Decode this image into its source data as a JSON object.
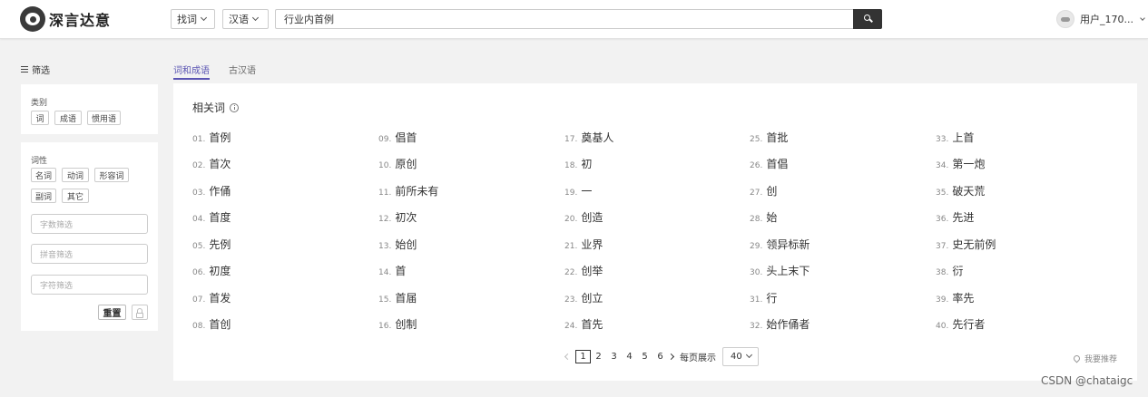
{
  "header": {
    "logo_text": "深言达意",
    "mode_select": "找词",
    "lang_select": "汉语",
    "search_value": "行业内首例",
    "user_name": "用户_170..."
  },
  "sidebar": {
    "filter_title": "筛选",
    "category_label": "类别",
    "category_tags": [
      "词",
      "成语",
      "惯用语"
    ],
    "pos_label": "词性",
    "pos_tags": [
      "名词",
      "动词",
      "形容词",
      "副词",
      "其它"
    ],
    "fields": [
      "字数筛选",
      "拼音筛选",
      "字符筛选"
    ],
    "reset_label": "重置"
  },
  "tabs": [
    {
      "label": "词和成语"
    },
    {
      "label": "古汉语"
    }
  ],
  "results": {
    "title": "相关词",
    "words": [
      {
        "num": "01.",
        "text": "首例"
      },
      {
        "num": "02.",
        "text": "首次"
      },
      {
        "num": "03.",
        "text": "作俑"
      },
      {
        "num": "04.",
        "text": "首度"
      },
      {
        "num": "05.",
        "text": "先例"
      },
      {
        "num": "06.",
        "text": "初度"
      },
      {
        "num": "07.",
        "text": "首发"
      },
      {
        "num": "08.",
        "text": "首创"
      },
      {
        "num": "09.",
        "text": "倡首"
      },
      {
        "num": "10.",
        "text": "原创"
      },
      {
        "num": "11.",
        "text": "前所未有"
      },
      {
        "num": "12.",
        "text": "初次"
      },
      {
        "num": "13.",
        "text": "始创"
      },
      {
        "num": "14.",
        "text": "首"
      },
      {
        "num": "15.",
        "text": "首届"
      },
      {
        "num": "16.",
        "text": "创制"
      },
      {
        "num": "17.",
        "text": "奠基人"
      },
      {
        "num": "18.",
        "text": "初"
      },
      {
        "num": "19.",
        "text": "一"
      },
      {
        "num": "20.",
        "text": "创造"
      },
      {
        "num": "21.",
        "text": "业界"
      },
      {
        "num": "22.",
        "text": "创举"
      },
      {
        "num": "23.",
        "text": "创立"
      },
      {
        "num": "24.",
        "text": "首先"
      },
      {
        "num": "25.",
        "text": "首批"
      },
      {
        "num": "26.",
        "text": "首倡"
      },
      {
        "num": "27.",
        "text": "创"
      },
      {
        "num": "28.",
        "text": "始"
      },
      {
        "num": "29.",
        "text": "领异标新"
      },
      {
        "num": "30.",
        "text": "头上末下"
      },
      {
        "num": "31.",
        "text": "行"
      },
      {
        "num": "32.",
        "text": "始作俑者"
      },
      {
        "num": "33.",
        "text": "上首"
      },
      {
        "num": "34.",
        "text": "第一炮"
      },
      {
        "num": "35.",
        "text": "破天荒"
      },
      {
        "num": "36.",
        "text": "先进"
      },
      {
        "num": "37.",
        "text": "史无前例"
      },
      {
        "num": "38.",
        "text": "衍"
      },
      {
        "num": "39.",
        "text": "率先"
      },
      {
        "num": "40.",
        "text": "先行者"
      }
    ]
  },
  "pagination": {
    "pages": [
      "1",
      "2",
      "3",
      "4",
      "5",
      "6"
    ],
    "current": "1",
    "per_page_label": "每页展示",
    "per_page_value": "40"
  },
  "recommend_label": "我要推荐",
  "watermark": "CSDN @chataigc"
}
